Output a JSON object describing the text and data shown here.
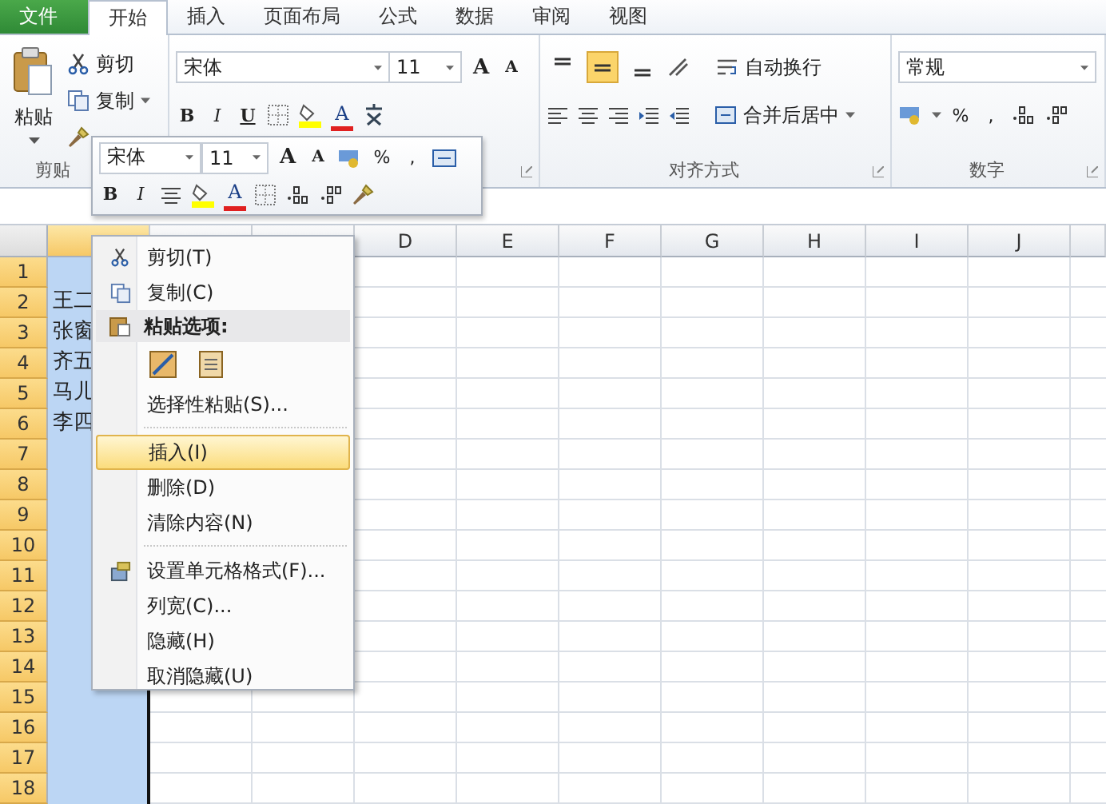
{
  "tabs": [
    {
      "label": "文件",
      "kind": "file",
      "selected": false
    },
    {
      "label": "开始",
      "kind": "tab",
      "selected": true
    },
    {
      "label": "插入",
      "kind": "tab",
      "selected": false
    },
    {
      "label": "页面布局",
      "kind": "tab",
      "selected": false
    },
    {
      "label": "公式",
      "kind": "tab",
      "selected": false
    },
    {
      "label": "数据",
      "kind": "tab",
      "selected": false
    },
    {
      "label": "审阅",
      "kind": "tab",
      "selected": false
    },
    {
      "label": "视图",
      "kind": "tab",
      "selected": false
    }
  ],
  "ribbon": {
    "clipboard": {
      "paste": "粘贴",
      "cut": "剪切",
      "copy": "复制",
      "label": "剪贴"
    },
    "font": {
      "name": "宋体",
      "size": "11",
      "grow": "A",
      "shrink": "A",
      "bold": "B",
      "italic": "I",
      "underline": "U",
      "color_letter": "A"
    },
    "alignment": {
      "vertical": [
        {
          "selected": false
        },
        {
          "selected": true
        },
        {
          "selected": false
        }
      ],
      "wrap": "自动换行",
      "merge": "合并后居中",
      "label": "对齐方式"
    },
    "number": {
      "format": "常规",
      "percent": "%",
      "comma": ",",
      "label": "数字"
    }
  },
  "mini_toolbar": {
    "font": "宋体",
    "size": "11",
    "grow": "A",
    "shrink": "A",
    "percent": "%",
    "comma": ",",
    "bold": "B",
    "italic": "I",
    "color_letter": "A"
  },
  "sheet": {
    "columns": [
      {
        "selected": true
      },
      {
        "selected": false
      },
      {
        "selected": false
      },
      {
        "label": "D",
        "selected": false
      },
      {
        "label": "E",
        "selected": false
      },
      {
        "label": "F",
        "selected": false
      },
      {
        "label": "G",
        "selected": false
      },
      {
        "label": "H",
        "selected": false
      },
      {
        "label": "I",
        "selected": false
      },
      {
        "label": "J",
        "selected": false
      },
      {
        "selected": false
      }
    ],
    "rows": [
      {
        "label": "1"
      },
      {
        "label": "2",
        "cell": "王二"
      },
      {
        "label": "3",
        "cell": "张窗"
      },
      {
        "label": "4",
        "cell": "齐五"
      },
      {
        "label": "5",
        "cell": "马儿"
      },
      {
        "label": "6",
        "cell": "李四"
      },
      {
        "label": "7"
      },
      {
        "label": "8"
      },
      {
        "label": "9"
      },
      {
        "label": "10"
      },
      {
        "label": "11"
      },
      {
        "label": "12"
      },
      {
        "label": "13"
      },
      {
        "label": "14"
      },
      {
        "label": "15"
      },
      {
        "label": "16"
      },
      {
        "label": "17"
      },
      {
        "label": "18"
      }
    ]
  },
  "context_menu": [
    {
      "kind": "cut",
      "label": "剪切(T)",
      "selected": false
    },
    {
      "kind": "copy",
      "label": "复制(C)",
      "selected": false
    },
    {
      "kind": "paste_header",
      "label": "粘贴选项:"
    },
    {
      "kind": "paste_buttons"
    },
    {
      "kind": "item",
      "label": "选择性粘贴(S)...",
      "selected": false
    },
    {
      "kind": "separator"
    },
    {
      "kind": "item",
      "label": "插入(I)",
      "selected": true
    },
    {
      "kind": "item",
      "label": "删除(D)",
      "selected": false
    },
    {
      "kind": "item",
      "label": "清除内容(N)",
      "selected": false
    },
    {
      "kind": "separator"
    },
    {
      "kind": "format",
      "label": "设置单元格格式(F)...",
      "selected": false
    },
    {
      "kind": "item",
      "label": "列宽(C)...",
      "selected": false
    },
    {
      "kind": "item",
      "label": "隐藏(H)",
      "selected": false
    },
    {
      "kind": "item",
      "label": "取消隐藏(U)",
      "selected": false
    }
  ]
}
